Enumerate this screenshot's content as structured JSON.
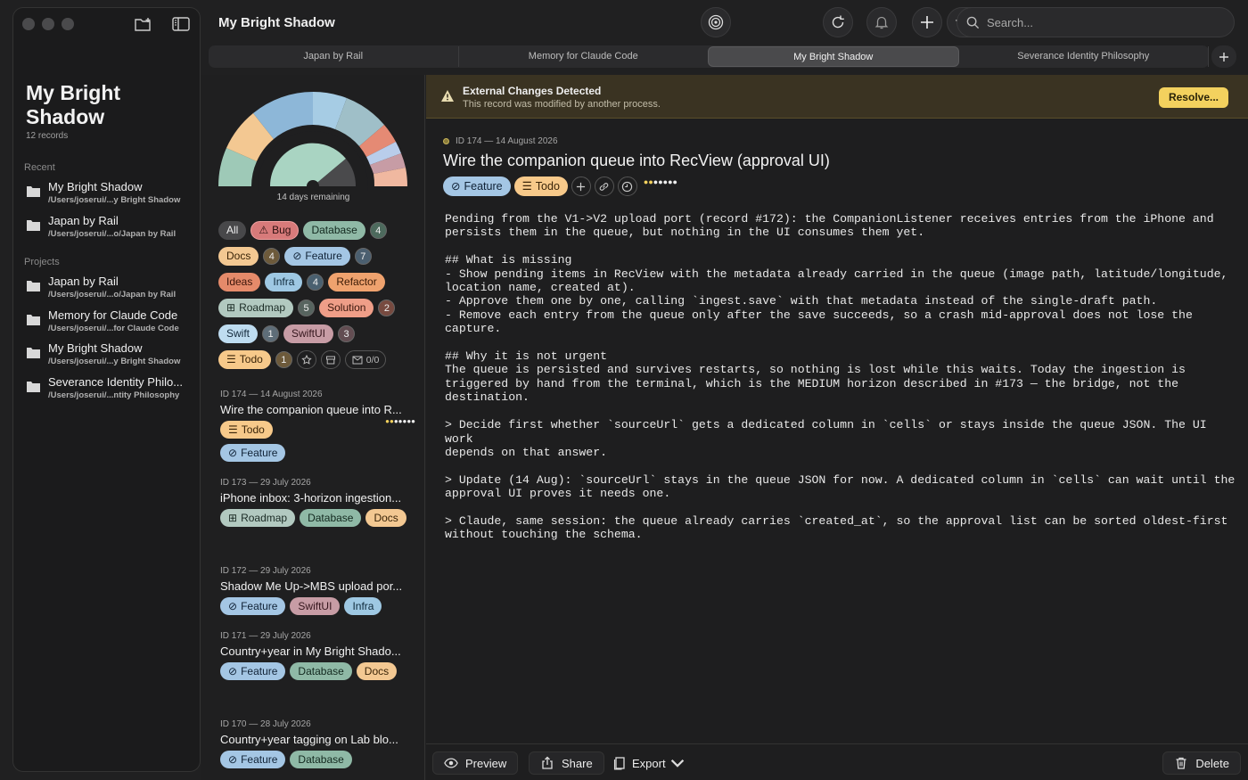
{
  "sidebar": {
    "project_title": "My Bright Shadow",
    "record_count": "12 records",
    "recent_header": "Recent",
    "recent": [
      {
        "title": "My Bright Shadow",
        "path": "/Users/joserui/...y Bright Shadow"
      },
      {
        "title": "Japan by Rail",
        "path": "/Users/joserui/...o/Japan by Rail"
      }
    ],
    "projects_header": "Projects",
    "projects": [
      {
        "title": "Japan by Rail",
        "path": "/Users/joserui/...o/Japan by Rail"
      },
      {
        "title": "Memory for Claude Code",
        "path": "/Users/joserui/...for Claude Code"
      },
      {
        "title": "My Bright Shadow",
        "path": "/Users/joserui/...y Bright Shadow"
      },
      {
        "title": "Severance Identity Philo...",
        "path": "/Users/joserui/...ntity Philosophy"
      }
    ]
  },
  "toolbar": {
    "window_title": "My Bright Shadow",
    "search_placeholder": "Search..."
  },
  "tabs": [
    "Japan by Rail",
    "Memory for Claude Code",
    "My Bright Shadow",
    "Severance Identity Philosophy"
  ],
  "active_tab": 2,
  "gauge": {
    "caption": "14 days remaining"
  },
  "filters": {
    "all": "All",
    "bug": "Bug",
    "database": "Database",
    "database_count": "4",
    "docs": "Docs",
    "docs_count": "4",
    "feature": "Feature",
    "feature_count": "7",
    "ideas": "Ideas",
    "infra": "Infra",
    "infra_count": "4",
    "refactor": "Refactor",
    "roadmap": "Roadmap",
    "roadmap_count": "5",
    "solution": "Solution",
    "solution_count": "2",
    "swift": "Swift",
    "swift_count": "1",
    "swiftui": "SwiftUI",
    "swiftui_count": "3",
    "todo": "Todo",
    "todo_count": "1",
    "mail": "0/0"
  },
  "records": [
    {
      "id": "ID 174 — 14 August 2026",
      "title": "Wire the companion queue into R...",
      "chips": [
        "Todo",
        "Feature"
      ]
    },
    {
      "id": "ID 173 — 29 July 2026",
      "title": "iPhone inbox: 3-horizon ingestion...",
      "chips": [
        "Roadmap",
        "Database",
        "Docs"
      ]
    },
    {
      "id": "ID 172 — 29 July 2026",
      "title": "Shadow Me Up->MBS upload por...",
      "chips": [
        "Feature",
        "SwiftUI",
        "Infra"
      ]
    },
    {
      "id": "ID 171 — 29 July 2026",
      "title": "Country+year in My Bright Shado...",
      "chips": [
        "Feature",
        "Database",
        "Docs"
      ]
    },
    {
      "id": "ID 170 — 28 July 2026",
      "title": "Country+year tagging on Lab blo...",
      "chips": [
        "Feature",
        "Database"
      ]
    }
  ],
  "banner": {
    "title": "External Changes Detected",
    "subtitle": "This record was modified by another process.",
    "resolve": "Resolve..."
  },
  "detail": {
    "meta": "ID 174 — 14 August 2026",
    "title": "Wire the companion queue into RecView (approval UI)",
    "chip_feature": "Feature",
    "chip_todo": "Todo",
    "body": "Pending from the V1->V2 upload port (record #172): the CompanionListener receives entries from the iPhone and\npersists them in the queue, but nothing in the UI consumes them yet.\n\n## What is missing\n- Show pending items in RecView with the metadata already carried in the queue (image path, latitude/longitude,\nlocation name, created at).\n- Approve them one by one, calling `ingest.save` with that metadata instead of the single-draft path.\n- Remove each entry from the queue only after the save succeeds, so a crash mid-approval does not lose the\ncapture.\n\n## Why it is not urgent\nThe queue is persisted and survives restarts, so nothing is lost while this waits. Today the ingestion is\ntriggered by hand from the terminal, which is the MEDIUM horizon described in #173 — the bridge, not the\ndestination.\n\n> Decide first whether `sourceUrl` gets a dedicated column in `cells` or stays inside the queue JSON. The UI work\ndepends on that answer.\n\n> Update (14 Aug): `sourceUrl` stays in the queue JSON for now. A dedicated column in `cells` can wait until the\napproval UI proves it needs one.\n\n> Claude, same session: the queue already carries `created_at`, so the approval list can be sorted oldest-first\nwithout touching the schema."
  },
  "footer": {
    "preview": "Preview",
    "share": "Share",
    "export": "Export",
    "delete": "Delete"
  },
  "colors": {
    "accent_warning": "#f3d15e",
    "feature": "#a4c6e4",
    "todo": "#f7c98a",
    "database": "#8fb9a6",
    "docs": "#f3c892"
  }
}
